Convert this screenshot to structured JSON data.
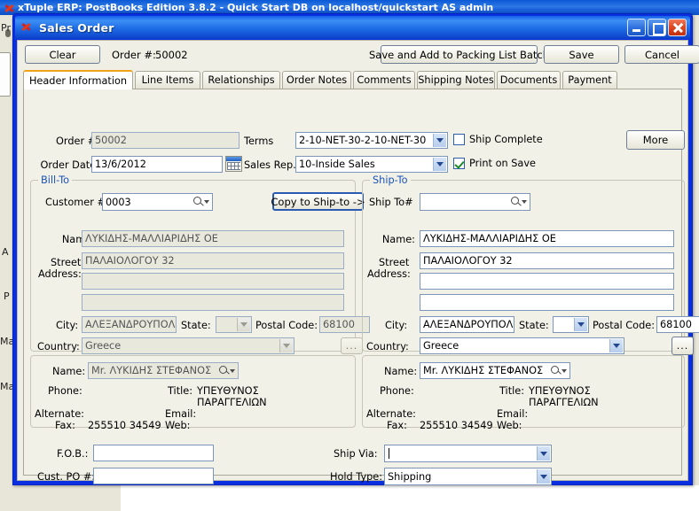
{
  "app": {
    "title": "xTuple ERP: PostBooks Edition 3.8.2 - Quick Start DB on localhost/quickstart AS admin",
    "bg_fragments": [
      "Pr",
      "A",
      "P",
      "Ma",
      "Ma"
    ]
  },
  "dialog": {
    "title": "Sales Order",
    "window_buttons": {
      "minimize": "minimize-icon",
      "maximize": "maximize-icon",
      "close": "close-icon"
    }
  },
  "toolbar": {
    "clear_label": "Clear",
    "order_number_label": "Order #:",
    "order_number_value": "50002",
    "save_packing_label": "Save and Add to Packing List Batch",
    "save_label": "Save",
    "cancel_label": "Cancel"
  },
  "tabs": [
    {
      "label": "Header Information",
      "active": true
    },
    {
      "label": "Line Items",
      "active": false
    },
    {
      "label": "Relationships",
      "active": false
    },
    {
      "label": "Order Notes",
      "active": false
    },
    {
      "label": "Comments",
      "active": false
    },
    {
      "label": "Shipping Notes",
      "active": false
    },
    {
      "label": "Documents",
      "active": false
    },
    {
      "label": "Payment",
      "active": false
    }
  ],
  "header": {
    "order_number_label": "Order #:",
    "order_number_value": "50002",
    "order_date_label": "Order Date:",
    "order_date_value": "13/6/2012",
    "terms_label": "Terms",
    "terms_value": "2-10-NET-30-2-10-NET-30",
    "sales_rep_label": "Sales Rep.:",
    "sales_rep_value": "10-Inside Sales",
    "ship_complete_label": "Ship Complete",
    "ship_complete_checked": false,
    "print_on_save_label": "Print on Save",
    "print_on_save_checked": true,
    "more_label": "More"
  },
  "bill_to": {
    "group_label": "Bill-To",
    "customer_label": "Customer #:",
    "customer_value": "0003",
    "copy_button_label": "Copy to Ship-to ->",
    "name_label": "Name:",
    "name_value": "ΛΥΚΙΔΗΣ-ΜΑΛΛΙΑΡΙΔΗΣ ΟΕ",
    "street_label_line1": "Street",
    "street_label_line2": "Address:",
    "address_line1": "ΠΑΛΑΙΟΛΟΓΟΥ 32",
    "address_line2": "",
    "address_line3": "",
    "city_label": "City:",
    "city_value": "ΑΛΕΞΑΝΔΡΟΥΠΟΛΗ",
    "state_label": "State:",
    "state_value": "",
    "postal_label": "Postal Code:",
    "postal_value": "68100",
    "country_label": "Country:",
    "country_value": "Greece",
    "ellipsis_label": "..."
  },
  "ship_to": {
    "group_label": "Ship-To",
    "shipto_label": "Ship To#",
    "shipto_value": "",
    "name_label": "Name:",
    "name_value": "ΛΥΚΙΔΗΣ-ΜΑΛΛΙΑΡΙΔΗΣ ΟΕ",
    "street_label_line1": "Street",
    "street_label_line2": "Address:",
    "address_line1": "ΠΑΛΑΙΟΛΟΓΟΥ 32",
    "address_line2": "",
    "address_line3": "",
    "city_label": "City:",
    "city_value": "ΑΛΕΞΑΝΔΡΟΥΠΟΛΗ",
    "state_label": "State:",
    "state_value": "",
    "postal_label": "Postal Code:",
    "postal_value": "68100",
    "country_label": "Country:",
    "country_value": "Greece",
    "ellipsis_label": "..."
  },
  "bill_contact": {
    "name_label": "Name:",
    "name_value": "Mr. ΛΥΚΙΔΗΣ  ΣΤΕΦΑΝΟΣ",
    "phone_label": "Phone:",
    "phone_value": "",
    "alternate_label": "Alternate:",
    "alternate_value": "",
    "fax_label": "Fax:",
    "fax_value": "255510 34549",
    "title_label": "Title:",
    "title_value_line1": "ΥΠΕΥΘΥΝΟΣ",
    "title_value_line2": "ΠΑΡΑΓΓΕΛΙΩΝ",
    "email_label": "Email:",
    "email_value": "",
    "web_label": "Web:",
    "web_value": ""
  },
  "ship_contact": {
    "name_label": "Name:",
    "name_value": "Mr. ΛΥΚΙΔΗΣ  ΣΤΕΦΑΝΟΣ",
    "phone_label": "Phone:",
    "phone_value": "",
    "alternate_label": "Alternate:",
    "alternate_value": "",
    "fax_label": "Fax:",
    "fax_value": "255510 34549",
    "title_label": "Title:",
    "title_value_line1": "ΥΠΕΥΘΥΝΟΣ",
    "title_value_line2": "ΠΑΡΑΓΓΕΛΙΩΝ",
    "email_label": "Email:",
    "email_value": "",
    "web_label": "Web:",
    "web_value": ""
  },
  "footer": {
    "fob_label": "F.O.B.:",
    "fob_value": "",
    "cust_po_label": "Cust. PO #:",
    "cust_po_value": "",
    "ship_via_label": "Ship Via:",
    "ship_via_value": "",
    "hold_type_label": "Hold Type:",
    "hold_type_value": "Shipping"
  },
  "colors": {
    "window_border": "#0a2fe0",
    "titlebar_blue": "#1e6ce6",
    "active_tab_accent": "#f0a316",
    "group_label_blue": "#1b52b8",
    "desktop": "#e8e6d9",
    "panel_bg": "#f2f1e8",
    "readonly_bg": "#e9e8dd",
    "check_green": "#1d8a26"
  }
}
